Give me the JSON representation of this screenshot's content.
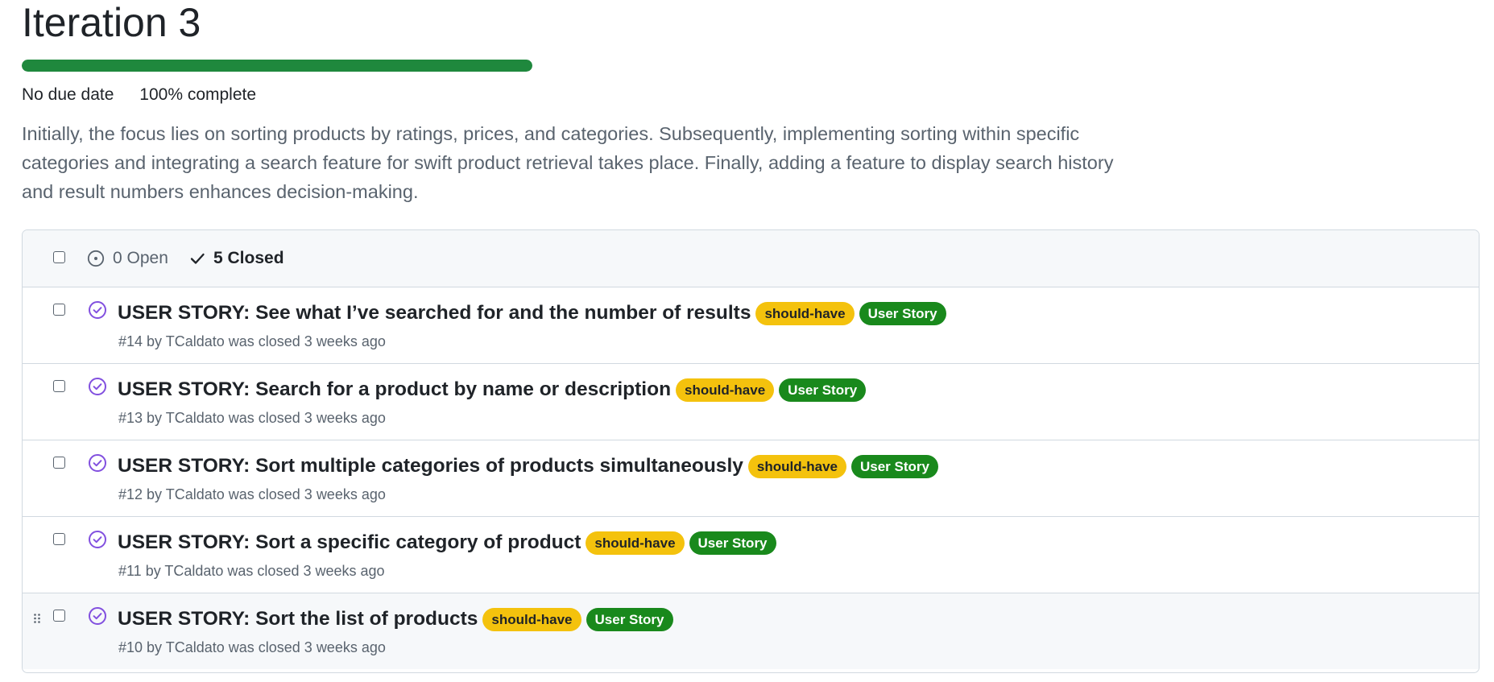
{
  "milestone": {
    "title": "Iteration 3",
    "progress_percent": 100,
    "due": "No due date",
    "complete_pct": "100%",
    "complete_word": " complete",
    "description": "Initially, the focus lies on sorting products by ratings, prices, and categories. Subsequently, implementing sorting within specific categories and integrating a search feature for swift product retrieval takes place. Finally, adding a feature to display search history and result numbers enhances decision-making."
  },
  "filters": {
    "open": "0 Open",
    "closed": "5 Closed"
  },
  "issues": [
    {
      "title": "USER STORY: See what I’ve searched for and the number of results",
      "labels": [
        "should-have",
        "User Story"
      ],
      "meta": "#14 by TCaldato was closed 3 weeks ago"
    },
    {
      "title": "USER STORY: Search for a product by name or description",
      "labels": [
        "should-have",
        "User Story"
      ],
      "meta": "#13 by TCaldato was closed 3 weeks ago"
    },
    {
      "title": "USER STORY: Sort multiple categories of products simultaneously",
      "labels": [
        "should-have",
        "User Story"
      ],
      "meta": "#12 by TCaldato was closed 3 weeks ago"
    },
    {
      "title": "USER STORY: Sort a specific category of product",
      "labels": [
        "should-have",
        "User Story"
      ],
      "meta": "#11 by TCaldato was closed 3 weeks ago"
    },
    {
      "title": "USER STORY: Sort the list of products",
      "labels": [
        "should-have",
        "User Story"
      ],
      "meta": "#10 by TCaldato was closed 3 weeks ago"
    }
  ],
  "colors": {
    "progress": "#1f883d",
    "closed_icon": "#8250df",
    "label_should_have": "#f4c20d",
    "label_user_story": "#19891c"
  },
  "icons": {
    "open": "issue-open-icon",
    "closed": "check-icon",
    "issue_status": "issue-closed-icon",
    "drag": "drag-handle-icon"
  }
}
